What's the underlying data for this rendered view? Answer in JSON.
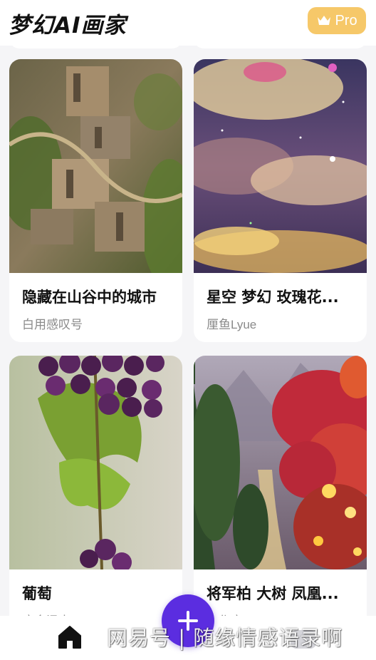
{
  "header": {
    "app_title": "梦幻AI画家",
    "pro_label": "Pro"
  },
  "cards": [
    {
      "title": "隐藏在山谷中的城市",
      "author": "白用感叹号",
      "image": "aerial-stone-city-in-valley"
    },
    {
      "title": "星空 梦幻 玫瑰花...",
      "author": "厘鱼Lyue",
      "image": "starry-pink-clouds-sky"
    },
    {
      "title": "葡萄",
      "author": "唐金泽中",
      "image": "purple-grapes-with-leaves"
    },
    {
      "title": "将军柏  大树  凤凰...",
      "author": "工作室",
      "image": "red-trees-river-landscape"
    }
  ],
  "bottom_nav": {
    "home_icon": "home-icon",
    "create_icon": "plus-icon",
    "profile_icon": "profile-icon"
  },
  "watermark": "网易号 | 随缘情感语录啊",
  "colors": {
    "pro_badge": "#f6c869",
    "fab": "#5b2de0",
    "background": "#f5f5f7"
  }
}
